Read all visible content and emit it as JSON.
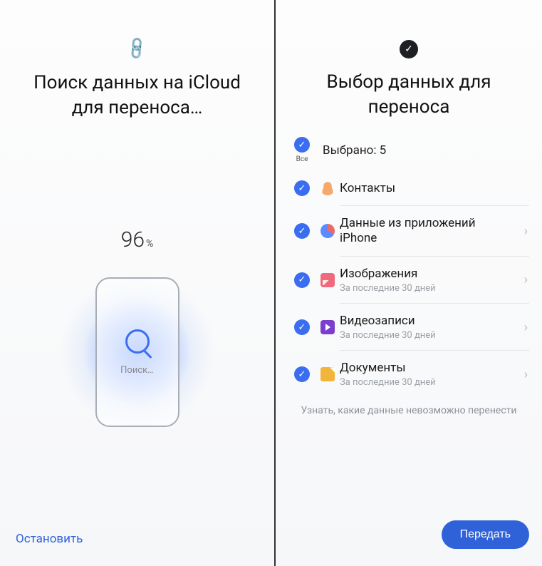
{
  "left": {
    "title": "Поиск данных на iCloud для переноса…",
    "progress_value": "96",
    "progress_unit": "%",
    "search_label": "Поиск…",
    "stop_label": "Остановить"
  },
  "right": {
    "title": "Выбор данных для переноса",
    "all_label": "Все",
    "selected_text": "Выбрано: 5",
    "items": [
      {
        "label": "Контакты",
        "sub": "",
        "has_chevron": false
      },
      {
        "label": "Данные из приложений iPhone",
        "sub": "",
        "has_chevron": true
      },
      {
        "label": "Изображения",
        "sub": "За последние 30 дней",
        "has_chevron": true
      },
      {
        "label": "Видеозаписи",
        "sub": "За последние 30 дней",
        "has_chevron": true
      },
      {
        "label": "Документы",
        "sub": "За последние 30 дней",
        "has_chevron": true
      }
    ],
    "footer_link": "Узнать, какие данные невозможно перенести",
    "transfer_label": "Передать"
  }
}
